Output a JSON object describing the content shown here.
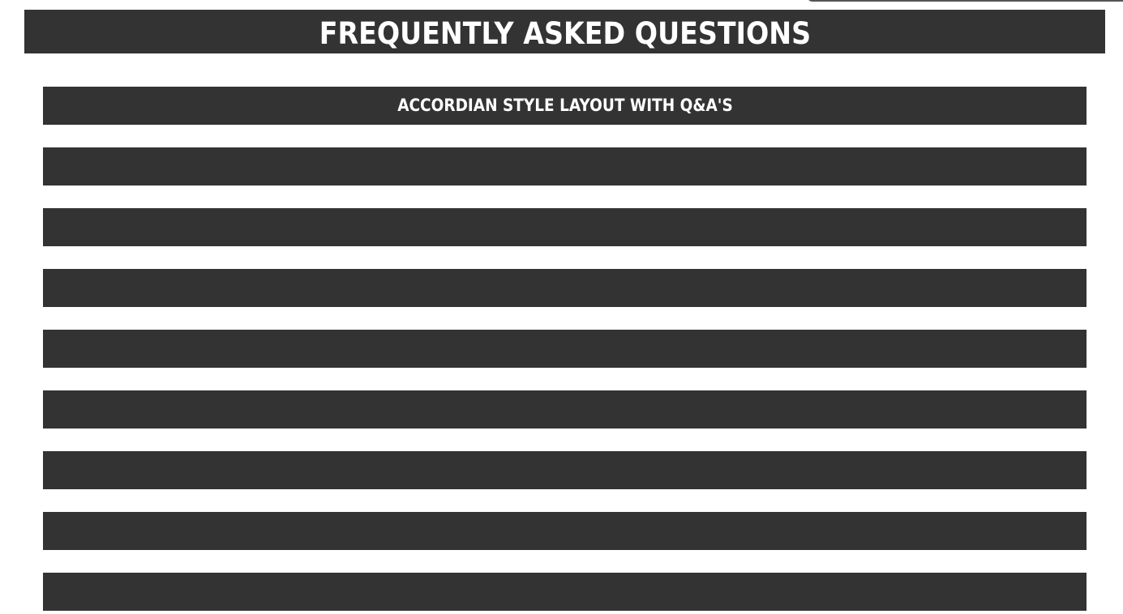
{
  "header": {
    "title": "FREQUENTLY ASKED QUESTIONS"
  },
  "accordion": {
    "items": [
      {
        "label": "ACCORDIAN STYLE LAYOUT WITH Q&A'S"
      },
      {
        "label": ""
      },
      {
        "label": ""
      },
      {
        "label": ""
      },
      {
        "label": ""
      },
      {
        "label": ""
      },
      {
        "label": ""
      },
      {
        "label": ""
      },
      {
        "label": ""
      }
    ]
  },
  "colors": {
    "bar_background": "#333333",
    "text": "#ffffff",
    "page_background": "#ffffff"
  }
}
